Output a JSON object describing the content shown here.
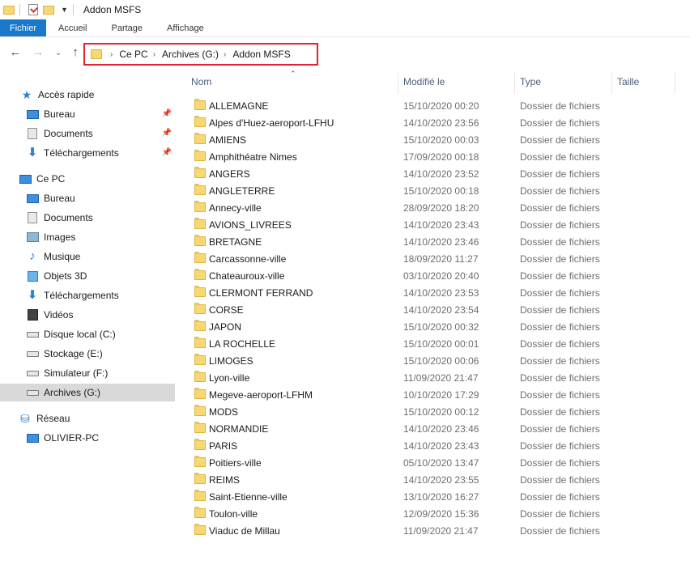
{
  "window": {
    "title": "Addon MSFS"
  },
  "ribbon": {
    "tabs": [
      {
        "label": "Fichier"
      },
      {
        "label": "Accueil"
      },
      {
        "label": "Partage"
      },
      {
        "label": "Affichage"
      }
    ]
  },
  "address": {
    "breadcrumbs": [
      "Ce PC",
      "Archives (G:)",
      "Addon MSFS"
    ],
    "highlight_color": "#e3202d"
  },
  "sidebar": {
    "items": [
      {
        "label": "Accès rapide",
        "icon": "star-icon"
      },
      {
        "label": "Bureau",
        "icon": "desktop-icon",
        "pinned": true
      },
      {
        "label": "Documents",
        "icon": "documents-icon",
        "pinned": true
      },
      {
        "label": "Téléchargements",
        "icon": "download-icon",
        "pinned": true
      },
      {
        "label": "Ce PC",
        "icon": "computer-icon"
      },
      {
        "label": "Bureau",
        "icon": "desktop-icon"
      },
      {
        "label": "Documents",
        "icon": "documents-icon"
      },
      {
        "label": "Images",
        "icon": "images-icon"
      },
      {
        "label": "Musique",
        "icon": "music-icon"
      },
      {
        "label": "Objets 3D",
        "icon": "cube-icon"
      },
      {
        "label": "Téléchargements",
        "icon": "download-icon"
      },
      {
        "label": "Vidéos",
        "icon": "video-icon"
      },
      {
        "label": "Disque local (C:)",
        "icon": "drive-icon"
      },
      {
        "label": "Stockage (E:)",
        "icon": "drive-icon"
      },
      {
        "label": "Simulateur (F:)",
        "icon": "drive-icon"
      },
      {
        "label": "Archives (G:)",
        "icon": "drive-icon",
        "selected": true
      },
      {
        "label": "Réseau",
        "icon": "network-icon"
      },
      {
        "label": "OLIVIER-PC",
        "icon": "computer-icon"
      }
    ]
  },
  "columns": {
    "name": "Nom",
    "modified": "Modifié le",
    "type": "Type",
    "size": "Taille"
  },
  "files": [
    {
      "name": "ALLEMAGNE",
      "date": "15/10/2020 00:20",
      "type": "Dossier de fichiers"
    },
    {
      "name": "Alpes d'Huez-aeroport-LFHU",
      "date": "14/10/2020 23:56",
      "type": "Dossier de fichiers"
    },
    {
      "name": "AMIENS",
      "date": "15/10/2020 00:03",
      "type": "Dossier de fichiers"
    },
    {
      "name": "Amphithéatre Nimes",
      "date": "17/09/2020 00:18",
      "type": "Dossier de fichiers"
    },
    {
      "name": "ANGERS",
      "date": "14/10/2020 23:52",
      "type": "Dossier de fichiers"
    },
    {
      "name": "ANGLETERRE",
      "date": "15/10/2020 00:18",
      "type": "Dossier de fichiers"
    },
    {
      "name": "Annecy-ville",
      "date": "28/09/2020 18:20",
      "type": "Dossier de fichiers"
    },
    {
      "name": "AVIONS_LIVREES",
      "date": "14/10/2020 23:43",
      "type": "Dossier de fichiers"
    },
    {
      "name": "BRETAGNE",
      "date": "14/10/2020 23:46",
      "type": "Dossier de fichiers"
    },
    {
      "name": "Carcassonne-ville",
      "date": "18/09/2020 11:27",
      "type": "Dossier de fichiers"
    },
    {
      "name": "Chateauroux-ville",
      "date": "03/10/2020 20:40",
      "type": "Dossier de fichiers"
    },
    {
      "name": "CLERMONT FERRAND",
      "date": "14/10/2020 23:53",
      "type": "Dossier de fichiers"
    },
    {
      "name": "CORSE",
      "date": "14/10/2020 23:54",
      "type": "Dossier de fichiers"
    },
    {
      "name": "JAPON",
      "date": "15/10/2020 00:32",
      "type": "Dossier de fichiers"
    },
    {
      "name": "LA ROCHELLE",
      "date": "15/10/2020 00:01",
      "type": "Dossier de fichiers"
    },
    {
      "name": "LIMOGES",
      "date": "15/10/2020 00:06",
      "type": "Dossier de fichiers"
    },
    {
      "name": "Lyon-ville",
      "date": "11/09/2020 21:47",
      "type": "Dossier de fichiers"
    },
    {
      "name": "Megeve-aeroport-LFHM",
      "date": "10/10/2020 17:29",
      "type": "Dossier de fichiers"
    },
    {
      "name": "MODS",
      "date": "15/10/2020 00:12",
      "type": "Dossier de fichiers"
    },
    {
      "name": "NORMANDIE",
      "date": "14/10/2020 23:46",
      "type": "Dossier de fichiers"
    },
    {
      "name": "PARIS",
      "date": "14/10/2020 23:43",
      "type": "Dossier de fichiers"
    },
    {
      "name": "Poitiers-ville",
      "date": "05/10/2020 13:47",
      "type": "Dossier de fichiers"
    },
    {
      "name": "REIMS",
      "date": "14/10/2020 23:55",
      "type": "Dossier de fichiers"
    },
    {
      "name": "Saint-Etienne-ville",
      "date": "13/10/2020 16:27",
      "type": "Dossier de fichiers"
    },
    {
      "name": "Toulon-ville",
      "date": "12/09/2020 15:36",
      "type": "Dossier de fichiers"
    },
    {
      "name": "Viaduc de Millau",
      "date": "11/09/2020 21:47",
      "type": "Dossier de fichiers"
    }
  ]
}
